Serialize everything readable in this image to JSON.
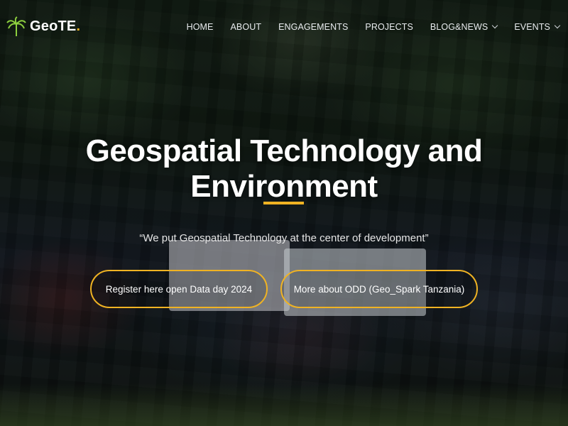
{
  "brand": {
    "name": "GeoTE",
    "dot": ".",
    "logo_icon": "palm-tree-icon",
    "dot_color": "#f0b323"
  },
  "nav": {
    "items": [
      {
        "label": "HOME",
        "dropdown": false
      },
      {
        "label": "ABOUT",
        "dropdown": false
      },
      {
        "label": "ENGAGEMENTS",
        "dropdown": false
      },
      {
        "label": "PROJECTS",
        "dropdown": false
      },
      {
        "label": "BLOG&NEWS",
        "dropdown": true
      },
      {
        "label": "EVENTS",
        "dropdown": true
      }
    ]
  },
  "hero": {
    "title": "Geospatial Technology and Environment",
    "tagline": "“We put Geospatial Technology at the center of development”",
    "accent_color": "#f0b323",
    "buttons": [
      {
        "label": "Register here open Data day 2024"
      },
      {
        "label": "More about ODD (Geo_Spark Tanzania)"
      }
    ]
  }
}
